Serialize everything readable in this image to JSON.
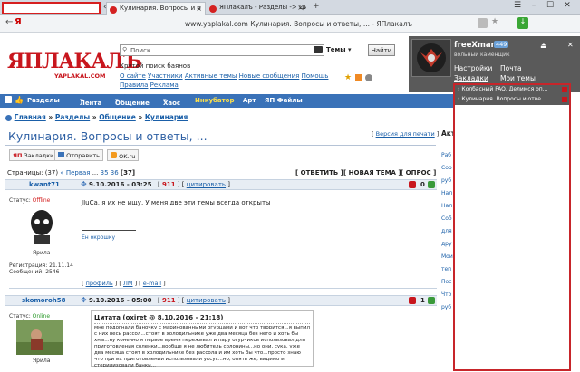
{
  "browser": {
    "tabs": [
      {
        "label": "Кулинария. Вопросы и о",
        "active": true
      },
      {
        "label": "ЯПлакалъ - Разделы -> Цит",
        "active": false
      }
    ],
    "new_tab_symbol": "+",
    "back_symbol": "‹",
    "address": "www.yaplakal.com  Кулинария. Вопросы и ответы, ... - ЯПлакалъ",
    "yandex_letter": "Я",
    "window_controls": [
      "☰",
      "–",
      "☐",
      "✕"
    ]
  },
  "site": {
    "logo": "ЯПЛАКАЛЪ",
    "logo_sub": "YAPLAKAL.COM",
    "search_placeholder": "Поиск...",
    "search_scope": "Темы",
    "search_button": "Найти",
    "tagline": "Крутой поиск баянов",
    "header_links": [
      "О сайте",
      "Участники",
      "Активные темы",
      "Новые сообщения",
      "Помощь",
      "Правила",
      "Реклама"
    ]
  },
  "user": {
    "name": "freeXman",
    "count": "449",
    "title": "вольный каменщик",
    "menu": [
      "Настройки",
      "Почта",
      "Закладки",
      "Мои темы"
    ],
    "bookmarks": [
      "Колбасный FAQ. Делимся оп...",
      "Кулинария. Вопросы и отве..."
    ]
  },
  "nav": [
    "Разделы",
    "Лента",
    "Общение",
    "Хаос",
    "Инкубатор",
    "Арт",
    "ЯП Файлы"
  ],
  "breadcrumb": [
    "Главная",
    "Разделы",
    "Общение",
    "Кулинария"
  ],
  "topic": {
    "title": "Кулинария. Вопросы и ответы, ...",
    "print_link": "Версия для печати",
    "share_buttons": [
      "Закладки",
      "Отправить",
      "OK.ru"
    ],
    "pages_label": "Страницы: (37)",
    "first_label": "« Первая",
    "page_links": [
      "35",
      "36",
      "37"
    ],
    "reply_buttons": [
      "ОТВЕТИТЬ",
      "НОВАЯ ТЕМА",
      "ОПРОС"
    ],
    "side_header": "Акт"
  },
  "posts": [
    {
      "author": "kwant71",
      "status_label": "Статус:",
      "status": "Offline",
      "group": "Ярила",
      "reg": "Регистрация: 21.11.14",
      "msgs": "Сообщений: 2546",
      "date": "9.10.2016 - 03:25",
      "num": "911",
      "quote_link": "цитировать",
      "rating": "0",
      "text": "JIuCa, я их не ищу. У меня две эти темы всегда открыты",
      "sig": "Ен окрошку",
      "footer": [
        "профиль",
        "ЛМ",
        "e-mail"
      ]
    },
    {
      "author": "skomoroh58",
      "status_label": "Статус:",
      "status": "Online",
      "group": "Ярила",
      "date": "9.10.2016 - 05:00",
      "num": "911",
      "quote_link": "цитировать",
      "rating": "1",
      "quote_head": "Цитата (oxiret @ 8.10.2016 - 21:18)",
      "quote_text": "мне подогнали баночку с маринованными огурцами и вот что творится...я выпил с них весь рассол...стоят в холодильнике уже два месяца без него и хоть бы хны...ну конечно я первое время переживал и пару огурчиков использовал для приготовления соленки...вообще я не любитель солонины...но они, сука, уже два месяца стоят в холодильнике без рассола и им хоть бы что...просто знаю что при их приготовлении использовали уксус...но, опять же, видимо и стерилизовали банки..."
    }
  ],
  "colors": {
    "brand_red": "#c8161d",
    "nav_blue": "#3a72b8",
    "offline": "#d42121",
    "online": "#2a9a2a",
    "highlight_red": "#d61f1f"
  }
}
